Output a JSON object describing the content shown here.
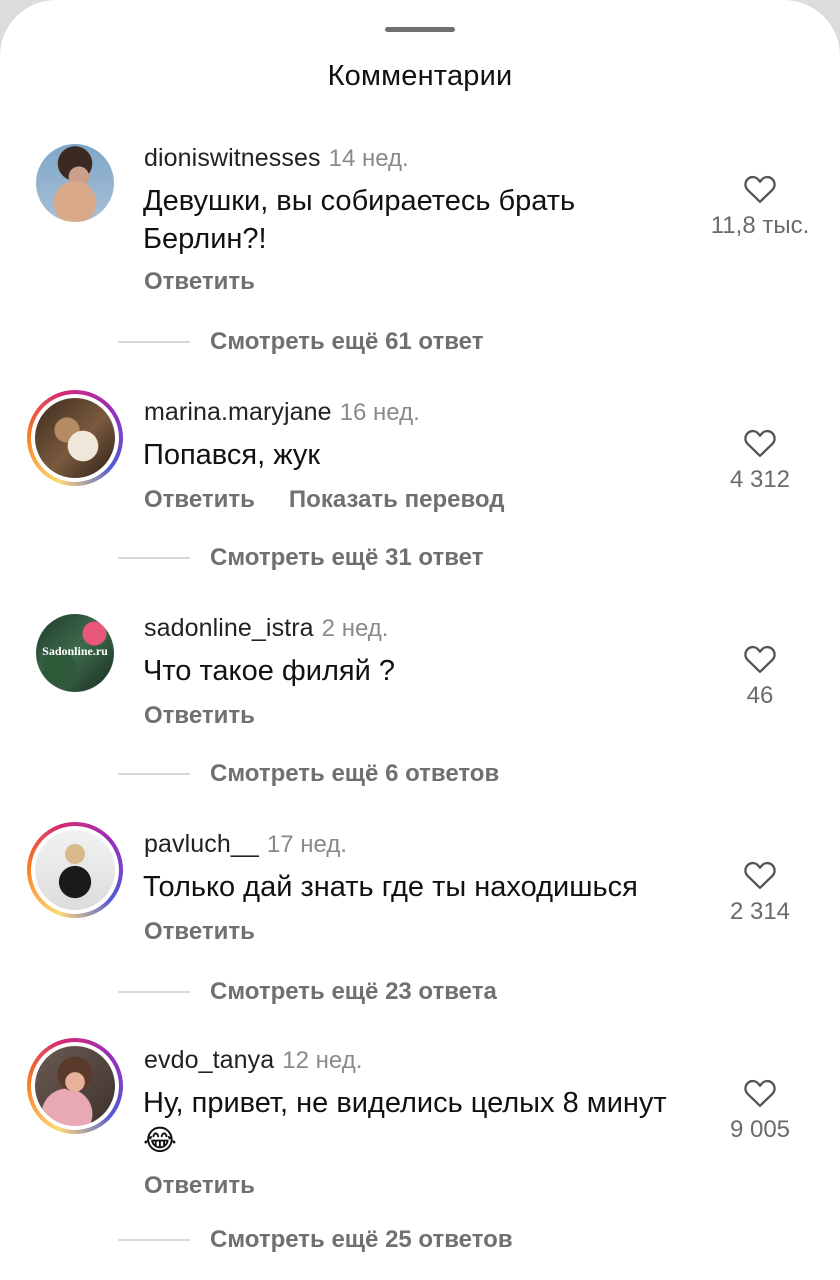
{
  "sheet": {
    "title": "Комментарии"
  },
  "comments": [
    {
      "username": "dioniswitnesses",
      "time": "14 нед.",
      "text": "Девушки, вы собираетесь брать Берлин?!",
      "reply_label": "Ответить",
      "translate_label": "",
      "likes": "11,8 тыс.",
      "replies_label": "Смотреть ещё 61 ответ",
      "heart_icon": "heart-outline-icon"
    },
    {
      "username": "marina.maryjane",
      "time": "16 нед.",
      "text": "Попався, жук",
      "reply_label": "Ответить",
      "translate_label": "Показать перевод",
      "likes": "4 312",
      "replies_label": "Смотреть ещё 31 ответ",
      "heart_icon": "heart-outline-icon"
    },
    {
      "username": "sadonline_istra",
      "time": "2 нед.",
      "text": "Что такое филяй ?",
      "reply_label": "Ответить",
      "translate_label": "",
      "likes": "46",
      "replies_label": "Смотреть ещё 6 ответов",
      "avatar_text": "Sadonline.ru",
      "heart_icon": "heart-outline-icon"
    },
    {
      "username": "pavluch__",
      "time": "17 нед.",
      "text": "Только дай знать где ты находишься",
      "reply_label": "Ответить",
      "translate_label": "",
      "likes": "2 314",
      "replies_label": "Смотреть ещё 23 ответа",
      "heart_icon": "heart-outline-icon"
    },
    {
      "username": "evdo_tanya",
      "time": "12 нед.",
      "text": "Ну, привет, не виделись целых 8 минут 😂",
      "reply_label": "Ответить",
      "translate_label": "",
      "likes": "9 005",
      "replies_label": "Смотреть ещё 25 ответов",
      "heart_icon": "heart-outline-icon"
    }
  ],
  "colors": {
    "story_ring": [
      "#feda75",
      "#fa7e1e",
      "#d62976",
      "#962fbf",
      "#4f5bd5"
    ],
    "meta_text": "#707070"
  }
}
